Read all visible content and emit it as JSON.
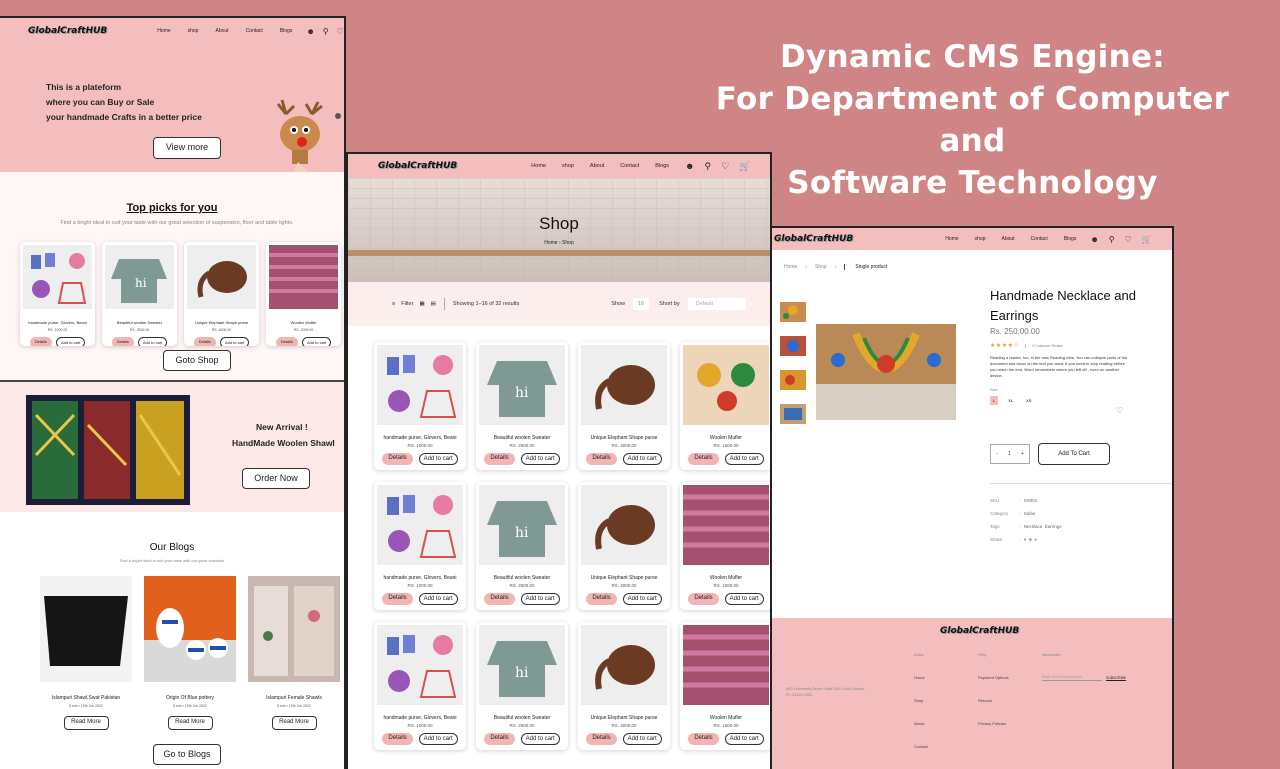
{
  "headline": [
    "Dynamic CMS Engine:",
    "For Department of Computer",
    "and",
    "Software Technology"
  ],
  "brand": "GlobalCraftHUB",
  "nav": [
    "Home",
    "shop",
    "About",
    "Contact",
    "Blogs"
  ],
  "panel1": {
    "hero_lines": [
      "This is a plateform",
      "where you can Buy or Sale",
      "your handmade Crafts in a better price"
    ],
    "hero_button": "View more",
    "picks_title": "Top picks for you",
    "picks_subtitle": "Find a bright ideal to suit your taste with our great selection of suspension, floor and table lights.",
    "products": [
      {
        "name": "handmade purse, Glovers, Beani",
        "price": "RS. 1000.00"
      },
      {
        "name": "Beautiful woolen Sweater",
        "price": "RS. 2500.00"
      },
      {
        "name": "Unique Elephant Shape purse",
        "price": "RS. 4000.00"
      },
      {
        "name": "Woolen Mufler",
        "price": "RS. 1000.00"
      }
    ],
    "details_label": "Details",
    "cart_label": "Add to cart",
    "shop_button": "Goto Shop",
    "arrival_line1": "New Arrival !",
    "arrival_line2": "HandMade Woolen Shawl",
    "order_button": "Order Now",
    "blogs_title": "Our Blogs",
    "blogs_subtitle": "Find a bright ideal to suit your taste with our great selection",
    "blogs": [
      {
        "title": "Islampuri Shawl,Swat Pakistan",
        "author": "5 min",
        "date": "12th Oct 2022"
      },
      {
        "title": "Origin Of Blue pottery",
        "author": "5 min",
        "date": "12th Oct 2022"
      },
      {
        "title": "Islampuri Female Shawls",
        "author": "5 min",
        "date": "12th Oct 2022"
      }
    ],
    "read_more": "Read More",
    "blogs_button": "Go to Blogs"
  },
  "panel2": {
    "title": "Shop",
    "crumb_home": "Home",
    "crumb_current": "Shop",
    "filter_label": "Filter",
    "results": "Showing 1–16 of 32 results",
    "show_label": "Show",
    "show_value": "16",
    "sort_label": "Short by",
    "sort_value": "Default",
    "rows": [
      [
        {
          "name": "handmade purse, Glovers, Beani",
          "price": "RS. 1000.00"
        },
        {
          "name": "Beautiful woolen Sweater",
          "price": "RS. 2500.00"
        },
        {
          "name": "Unique Elephant Shape purse",
          "price": "RS. 4000.00"
        },
        {
          "name": "Woolen Mufler",
          "price": "RS. 1000.00"
        }
      ],
      [
        {
          "name": "handmade purse, Glovers, Beani",
          "price": "RS. 1000.00"
        },
        {
          "name": "Beautiful woolen Sweater",
          "price": "RS. 2500.00"
        },
        {
          "name": "Unique Elephant Shape purse",
          "price": "RS. 4000.00"
        },
        {
          "name": "Woolen Mufler",
          "price": "RS. 1000.00"
        }
      ],
      [
        {
          "name": "handmade purse, Glovers, Beani",
          "price": "RS. 1000.00"
        },
        {
          "name": "Beautiful woolen Sweater",
          "price": "RS. 2500.00"
        },
        {
          "name": "Unique Elephant Shape purse",
          "price": "RS. 4000.00"
        },
        {
          "name": "Woolen Mufler",
          "price": "RS. 1000.00"
        }
      ]
    ],
    "details_label": "Details",
    "cart_label": "Add to cart"
  },
  "panel3": {
    "crumb_home": "Home",
    "crumb_shop": "Shop",
    "crumb_current": "Single product",
    "title": "Handmade Necklace and Earrings",
    "price": "Rs. 250,00.00",
    "rating": 4.5,
    "stars_text": "★★★★☆",
    "reviews": "5 Customer Review",
    "description": "Reading a reader, too, in the new Reading view. You can collapse parts of the document and focus on the text you want. If you need to stop reading before you reach the end, Word remembers where you left off - even on another device.",
    "size_label": "Size",
    "sizes": [
      "L",
      "XL",
      "XS"
    ],
    "qty_minus": "-",
    "qty": "1",
    "qty_plus": "+",
    "add_button": "Add To Cart",
    "meta": [
      {
        "k": "SKU",
        "v": "SS001"
      },
      {
        "k": "Category",
        "v": "Sofas"
      },
      {
        "k": "Tags",
        "v": "Necklace, Earrings"
      },
      {
        "k": "Share",
        "v": ""
      }
    ],
    "footer": {
      "address": "400 University Drive Suite 200 Coral Gables, FL 33134 USA",
      "links_title": "Links",
      "links": [
        "Home",
        "Shop",
        "About",
        "Contact"
      ],
      "help_title": "Help",
      "help": [
        "Payment Options",
        "Returns",
        "Privacy Policies"
      ],
      "news_title": "Newsletter",
      "news_placeholder": "Enter Your Email Address",
      "news_button": "SUBSCRIBE"
    }
  },
  "colors": {
    "background": "#cf8585",
    "pink": "#f5bebe",
    "pink_light": "#fdeeee",
    "button_pink": "#f3b4b4"
  }
}
